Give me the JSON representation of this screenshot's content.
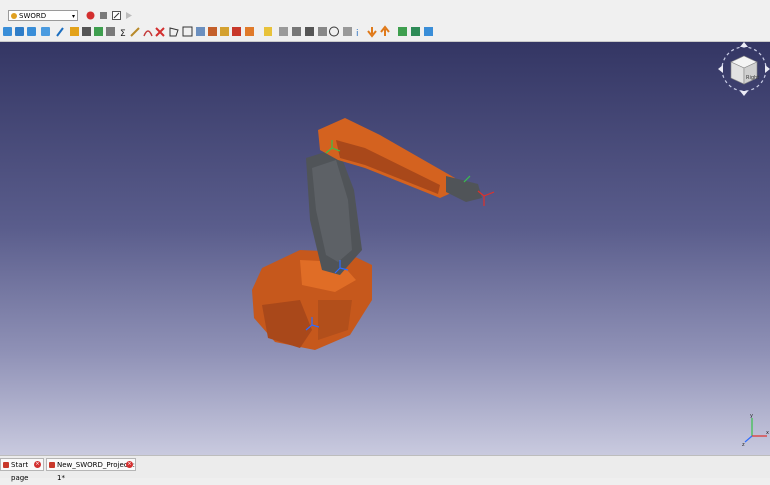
{
  "toolbar": {
    "workbench_label": "SWORD",
    "record_icon": "record-icon",
    "stop_icon": "stop-icon",
    "macro_icon": "macro-edit-icon",
    "play_icon": "play-icon"
  },
  "tools": [
    "view-fit-icon",
    "view-box-icon",
    "view-iso-icon",
    "view-front-icon",
    "measure-icon",
    "part-icon",
    "body-icon",
    "group-icon",
    "link-icon",
    "url-icon",
    "sigma-icon",
    "pencil-icon",
    "arc-icon",
    "delete-icon",
    "polygon-icon",
    "fillet-icon",
    "constraint-icon",
    "distance-icon",
    "grid-icon",
    "symmetry-icon",
    "document-icon",
    "image-icon",
    "box-icon",
    "clock-icon",
    "hand-icon",
    "info-icon",
    "down-arrow-icon",
    "up-arrow-icon",
    "split-icon",
    "merge-icon"
  ],
  "tabs": [
    {
      "label": "Start page"
    },
    {
      "label": "New_SWORD_Project : 1*"
    }
  ],
  "navcube_label": "Right",
  "colors": {
    "robot_orange": "#d4621f",
    "robot_dark_orange": "#a9481a",
    "robot_grey": "#505458",
    "viewport_top": "#343664",
    "viewport_bottom": "#c9cadf"
  }
}
